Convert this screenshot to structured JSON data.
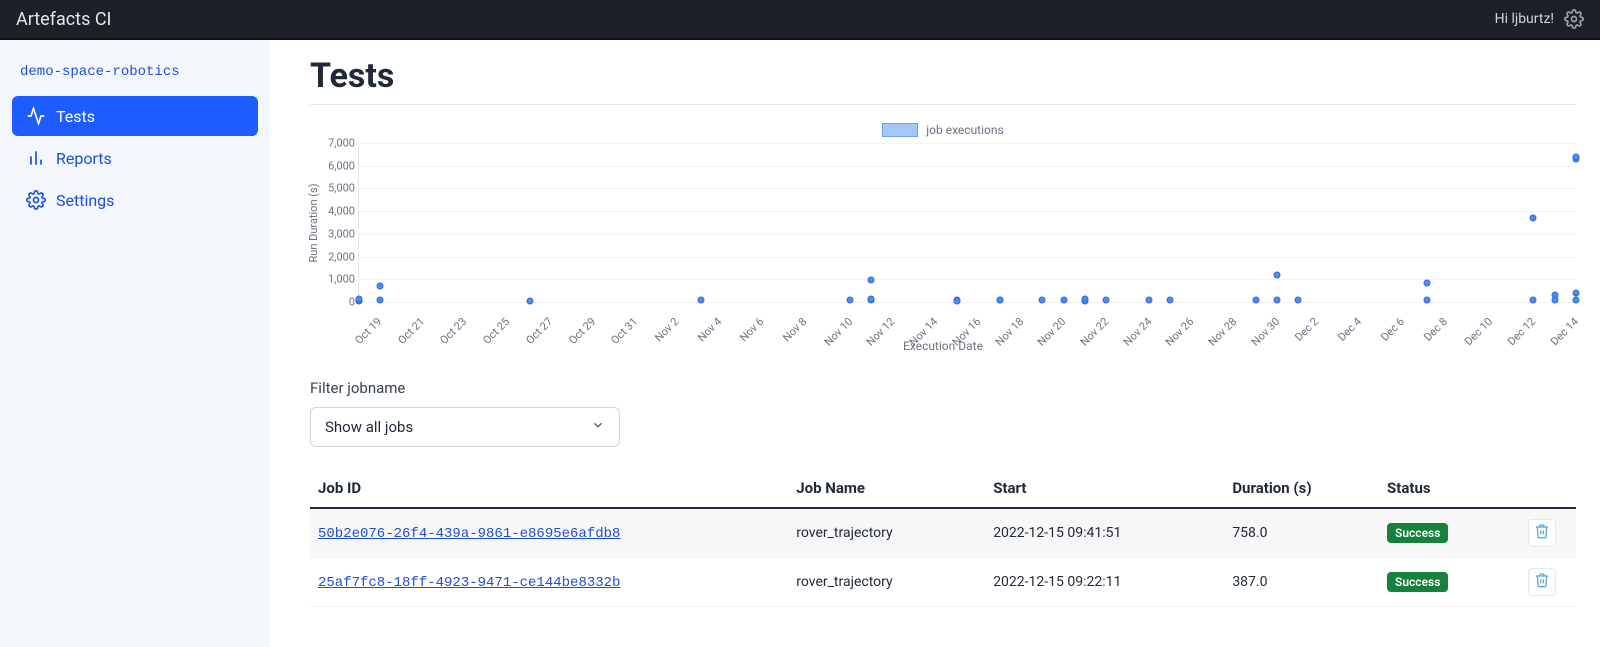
{
  "header": {
    "brand": "Artefacts CI",
    "greeting": "Hi ljburtz!"
  },
  "sidebar": {
    "project": "demo-space-robotics",
    "items": [
      {
        "label": "Tests",
        "icon": "activity-icon",
        "active": true
      },
      {
        "label": "Reports",
        "icon": "bar-chart-icon",
        "active": false
      },
      {
        "label": "Settings",
        "icon": "gear-icon",
        "active": false
      }
    ]
  },
  "main": {
    "title": "Tests",
    "filter": {
      "label": "Filter jobname",
      "selected": "Show all jobs"
    },
    "table": {
      "headers": [
        "Job ID",
        "Job Name",
        "Start",
        "Duration (s)",
        "Status",
        ""
      ],
      "rows": [
        {
          "id": "50b2e076-26f4-439a-9861-e8695e6afdb8",
          "name": "rover_trajectory",
          "start": "2022-12-15 09:41:51",
          "duration": "758.0",
          "status": "Success"
        },
        {
          "id": "25af7fc8-18ff-4923-9471-ce144be8332b",
          "name": "rover_trajectory",
          "start": "2022-12-15 09:22:11",
          "duration": "387.0",
          "status": "Success"
        }
      ]
    }
  },
  "chart_data": {
    "type": "scatter",
    "title": "",
    "legend": "job executions",
    "xlabel": "Execution Date",
    "ylabel": "Run Duration (s)",
    "ylim": [
      0,
      7000
    ],
    "yticks": [
      0,
      1000,
      2000,
      3000,
      4000,
      5000,
      6000,
      7000
    ],
    "xticks": [
      "Oct 19",
      "Oct 21",
      "Oct 23",
      "Oct 25",
      "Oct 27",
      "Oct 29",
      "Oct 31",
      "Nov 2",
      "Nov 4",
      "Nov 6",
      "Nov 8",
      "Nov 10",
      "Nov 12",
      "Nov 14",
      "Nov 16",
      "Nov 18",
      "Nov 20",
      "Nov 22",
      "Nov 24",
      "Nov 26",
      "Nov 28",
      "Nov 30",
      "Dec 2",
      "Dec 4",
      "Dec 6",
      "Dec 8",
      "Dec 10",
      "Dec 12",
      "Dec 14"
    ],
    "series": [
      {
        "name": "job executions",
        "points": [
          {
            "x": "Oct 19",
            "y": 50
          },
          {
            "x": "Oct 19",
            "y": 100
          },
          {
            "x": "Oct 19",
            "y": 120
          },
          {
            "x": "Oct 20",
            "y": 80
          },
          {
            "x": "Oct 20",
            "y": 700
          },
          {
            "x": "Oct 27",
            "y": 50
          },
          {
            "x": "Nov 4",
            "y": 80
          },
          {
            "x": "Nov 11",
            "y": 100
          },
          {
            "x": "Nov 12",
            "y": 80
          },
          {
            "x": "Nov 12",
            "y": 120
          },
          {
            "x": "Nov 12",
            "y": 950
          },
          {
            "x": "Nov 16",
            "y": 90
          },
          {
            "x": "Nov 16",
            "y": 60
          },
          {
            "x": "Nov 18",
            "y": 100
          },
          {
            "x": "Nov 18",
            "y": 70
          },
          {
            "x": "Nov 20",
            "y": 80
          },
          {
            "x": "Nov 21",
            "y": 90
          },
          {
            "x": "Nov 22",
            "y": 100
          },
          {
            "x": "Nov 22",
            "y": 60
          },
          {
            "x": "Nov 22",
            "y": 130
          },
          {
            "x": "Nov 23",
            "y": 90
          },
          {
            "x": "Nov 25",
            "y": 80
          },
          {
            "x": "Nov 26",
            "y": 90
          },
          {
            "x": "Nov 30",
            "y": 90
          },
          {
            "x": "Dec 1",
            "y": 1200
          },
          {
            "x": "Dec 1",
            "y": 100
          },
          {
            "x": "Dec 2",
            "y": 80
          },
          {
            "x": "Dec 8",
            "y": 90
          },
          {
            "x": "Dec 8",
            "y": 850
          },
          {
            "x": "Dec 13",
            "y": 80
          },
          {
            "x": "Dec 13",
            "y": 3700
          },
          {
            "x": "Dec 14",
            "y": 100
          },
          {
            "x": "Dec 14",
            "y": 300
          },
          {
            "x": "Dec 15",
            "y": 6300
          },
          {
            "x": "Dec 15",
            "y": 6400
          },
          {
            "x": "Dec 15",
            "y": 400
          },
          {
            "x": "Dec 15",
            "y": 90
          }
        ]
      }
    ]
  }
}
